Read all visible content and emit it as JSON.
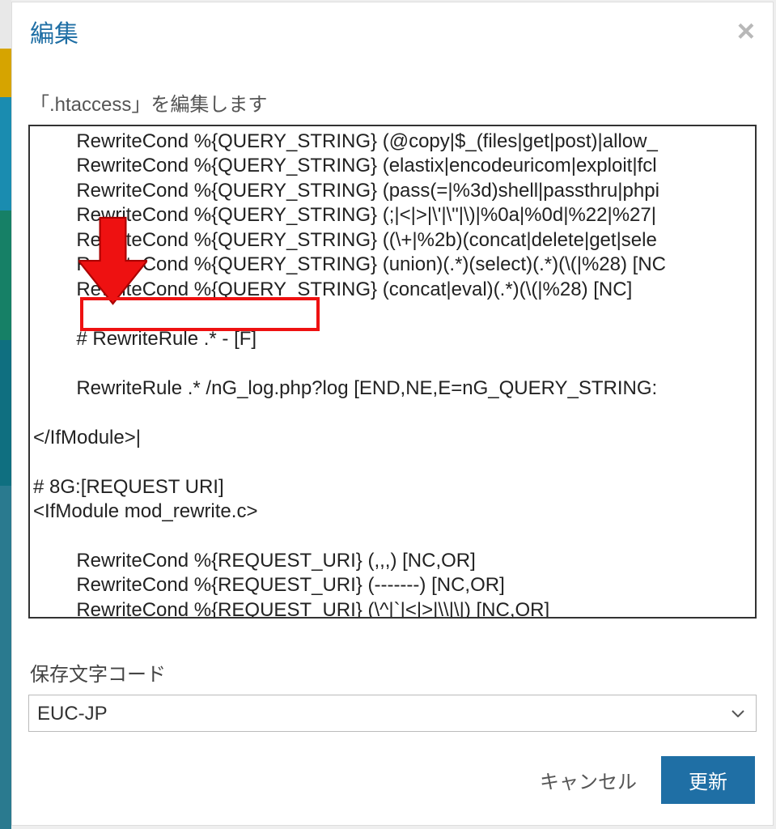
{
  "modal": {
    "title": "編集",
    "close_label": "×",
    "subtitle": "「.htaccess」を編集します",
    "editor_content": "\tRewriteCond %{QUERY_STRING} (@copy|$_(files|get|post)|allow_\n\tRewriteCond %{QUERY_STRING} (elastix|encodeuricom|exploit|fcl\n\tRewriteCond %{QUERY_STRING} (pass(=|%3d)shell|passthru|phpi\n\tRewriteCond %{QUERY_STRING} (;|<|>|\\'|\\\"|\\)|%0a|%0d|%22|%27|\n\tRewriteCond %{QUERY_STRING} ((\\+|%2b)(concat|delete|get|sele\n\tRewriteCond %{QUERY_STRING} (union)(.*)(select)(.*)(\\(|%28) [NC\n\tRewriteCond %{QUERY_STRING} (concat|eval)(.*)(\\(|%28) [NC]\n\n\t# RewriteRule .* - [F]\n\n\tRewriteRule .* /nG_log.php?log [END,NE,E=nG_QUERY_STRING:\n\n</IfModule>|\n\n# 8G:[REQUEST URI]\n<IfModule mod_rewrite.c>\n\n\tRewriteCond %{REQUEST_URI} (,,,) [NC,OR]\n\tRewriteCond %{REQUEST_URI} (-------) [NC,OR]\n\tRewriteCond %{REQUEST_URI} (\\^|`|<|>|\\\\|\\|) [NC,OR]\n",
    "encoding_label": "保存文字コード",
    "encoding_value": "EUC-JP",
    "encoding_options": [
      "EUC-JP"
    ],
    "cancel_label": "キャンセル",
    "submit_label": "更新"
  },
  "annotation": {
    "highlighted_line": "# RewriteRule .* - [F]"
  }
}
